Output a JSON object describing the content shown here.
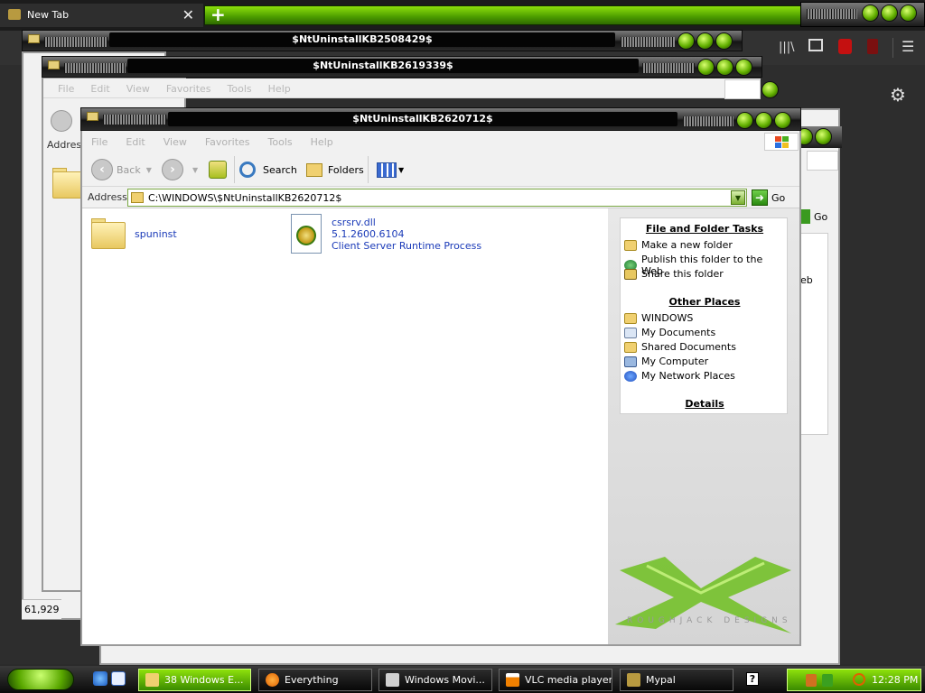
{
  "browser": {
    "tab_title": "New Tab",
    "tab_close": "✕",
    "new_tab": "+"
  },
  "windows": {
    "bg1_title": "$NtUninstallKB2508429$",
    "bg2_title": "$NtUninstallKB2619339$",
    "bg2_address_label": "Addres",
    "bg1_status": "61,929"
  },
  "explorer": {
    "title": "$NtUninstallKB2620712$",
    "menu": [
      "File",
      "Edit",
      "View",
      "Favorites",
      "Tools",
      "Help"
    ],
    "toolbar": {
      "back": "Back",
      "search": "Search",
      "folders": "Folders"
    },
    "address": {
      "label": "Address",
      "value": "C:\\WINDOWS\\$NtUninstallKB2620712$",
      "go": "Go"
    },
    "items": [
      {
        "name": "spuninst",
        "type": "folder"
      },
      {
        "name": "csrsrv.dll",
        "version": "5.1.2600.6104",
        "description": "Client Server Runtime Process",
        "type": "dll"
      }
    ],
    "tasks_panel": {
      "file_tasks_title": "File and Folder Tasks",
      "file_tasks": [
        "Make a new folder",
        "Publish this folder to the Web",
        "Share this folder"
      ],
      "other_places_title": "Other Places",
      "other_places": [
        "WINDOWS",
        "My Documents",
        "Shared Documents",
        "My Computer",
        "My Network Places"
      ],
      "details_title": "Details"
    },
    "watermark": "ROUGHJACK DESIGNS"
  },
  "bg_partial": {
    "go": "Go",
    "web": "eb"
  },
  "taskbar": {
    "tasks": [
      {
        "label": "38 Windows E...",
        "icon": "folder-icon"
      },
      {
        "label": "Everything",
        "icon": "search-icon"
      },
      {
        "label": "Windows Movi...",
        "icon": "film-icon"
      },
      {
        "label": "VLC media player",
        "icon": "vlc-cone-icon"
      },
      {
        "label": "Mypal",
        "icon": "mypal-icon"
      }
    ],
    "clock": "12:28 PM",
    "help": "?"
  },
  "colors": {
    "accent_green": "#6fc600",
    "link_blue": "#1a3ab8"
  }
}
